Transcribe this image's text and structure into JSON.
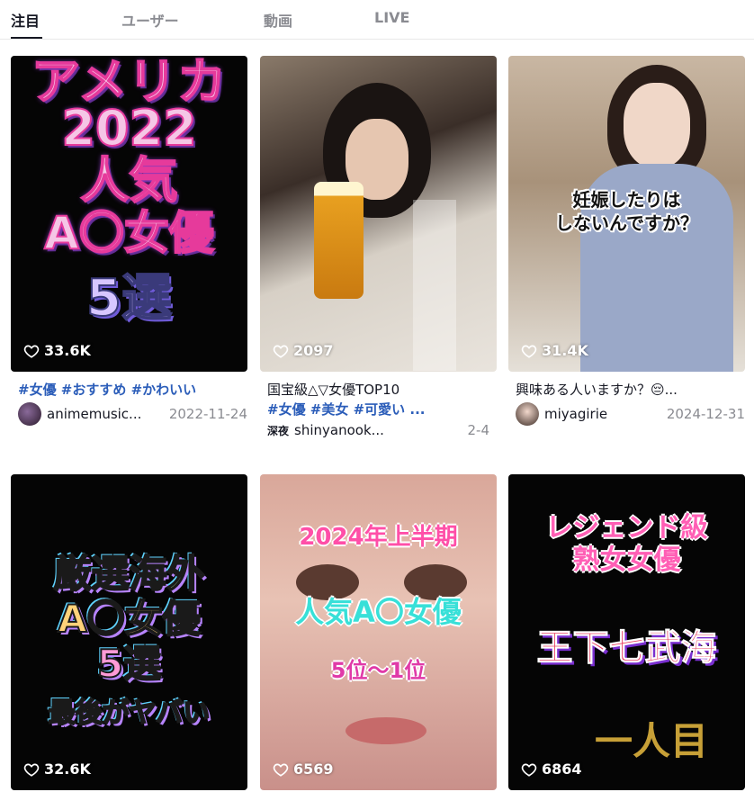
{
  "tabs": [
    {
      "label": "注目",
      "active": true
    },
    {
      "label": "ユーザー",
      "active": false
    },
    {
      "label": "動画",
      "active": false
    },
    {
      "label": "LIVE",
      "active": false
    }
  ],
  "videos": [
    {
      "overlay_lines": [
        "アメリカ",
        "2022",
        "人気",
        "A〇女優",
        "5選"
      ],
      "likes": "33.6K",
      "caption": "",
      "tags": "#女優 #おすすめ #かわいい",
      "username": "animemusic...",
      "date": "2022-11-24"
    },
    {
      "overlay_lines": [],
      "likes": "2097",
      "caption": "国宝級△▽女優TOP10",
      "tags": "#女優 #美女 #可愛い ...",
      "badge": "深夜",
      "username": "shinyanook...",
      "date": "2-4"
    },
    {
      "overlay_lines": [
        "妊娠したりは",
        "しないんですか？"
      ],
      "likes": "31.4K",
      "caption": "興味ある人いますか？😔...",
      "tags": "",
      "username": "miyagirie",
      "date": "2024-12-31"
    },
    {
      "overlay_lines": [
        "厳選海外",
        "A〇女優",
        "5選",
        "最後がヤバい"
      ],
      "likes": "32.6K"
    },
    {
      "overlay_lines": [
        "2024年上半期",
        "人気A〇女優",
        "5位〜1位"
      ],
      "likes": "6569"
    },
    {
      "overlay_lines": [
        "レジェンド級",
        "熟女女優",
        "王下七武海",
        "一人目"
      ],
      "likes": "6864"
    }
  ],
  "icons": {
    "like": "heart-outline-icon"
  },
  "colors": {
    "tag_link": "#2b5db9",
    "muted": "#8a8b91"
  }
}
